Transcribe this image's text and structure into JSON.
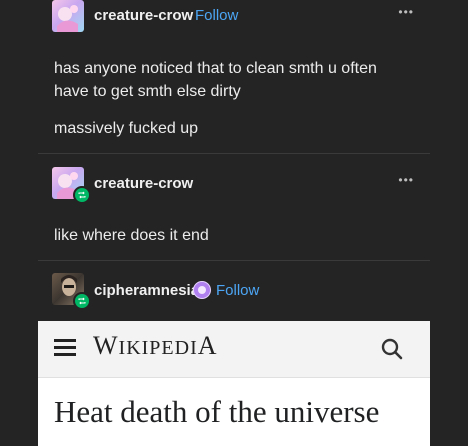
{
  "posts": [
    {
      "username": "creature-crow",
      "follow_label": "Follow",
      "menu_label": "•••",
      "lines": [
        "has anyone noticed that to clean smth u often",
        "have to get smth else dirty"
      ],
      "line2": "massively fucked up"
    },
    {
      "username": "creature-crow",
      "menu_label": "•••",
      "text": "like where does it end"
    },
    {
      "username": "cipheramnesia",
      "follow_label": "Follow"
    }
  ],
  "wikipedia": {
    "logo_w": "W",
    "logo_rest": "IKIPEDI",
    "logo_a": "A",
    "title": "Heat death of the universe"
  },
  "colors": {
    "background": "#242424",
    "follow": "#4ca6f5",
    "reblog_badge": "#00b765"
  }
}
